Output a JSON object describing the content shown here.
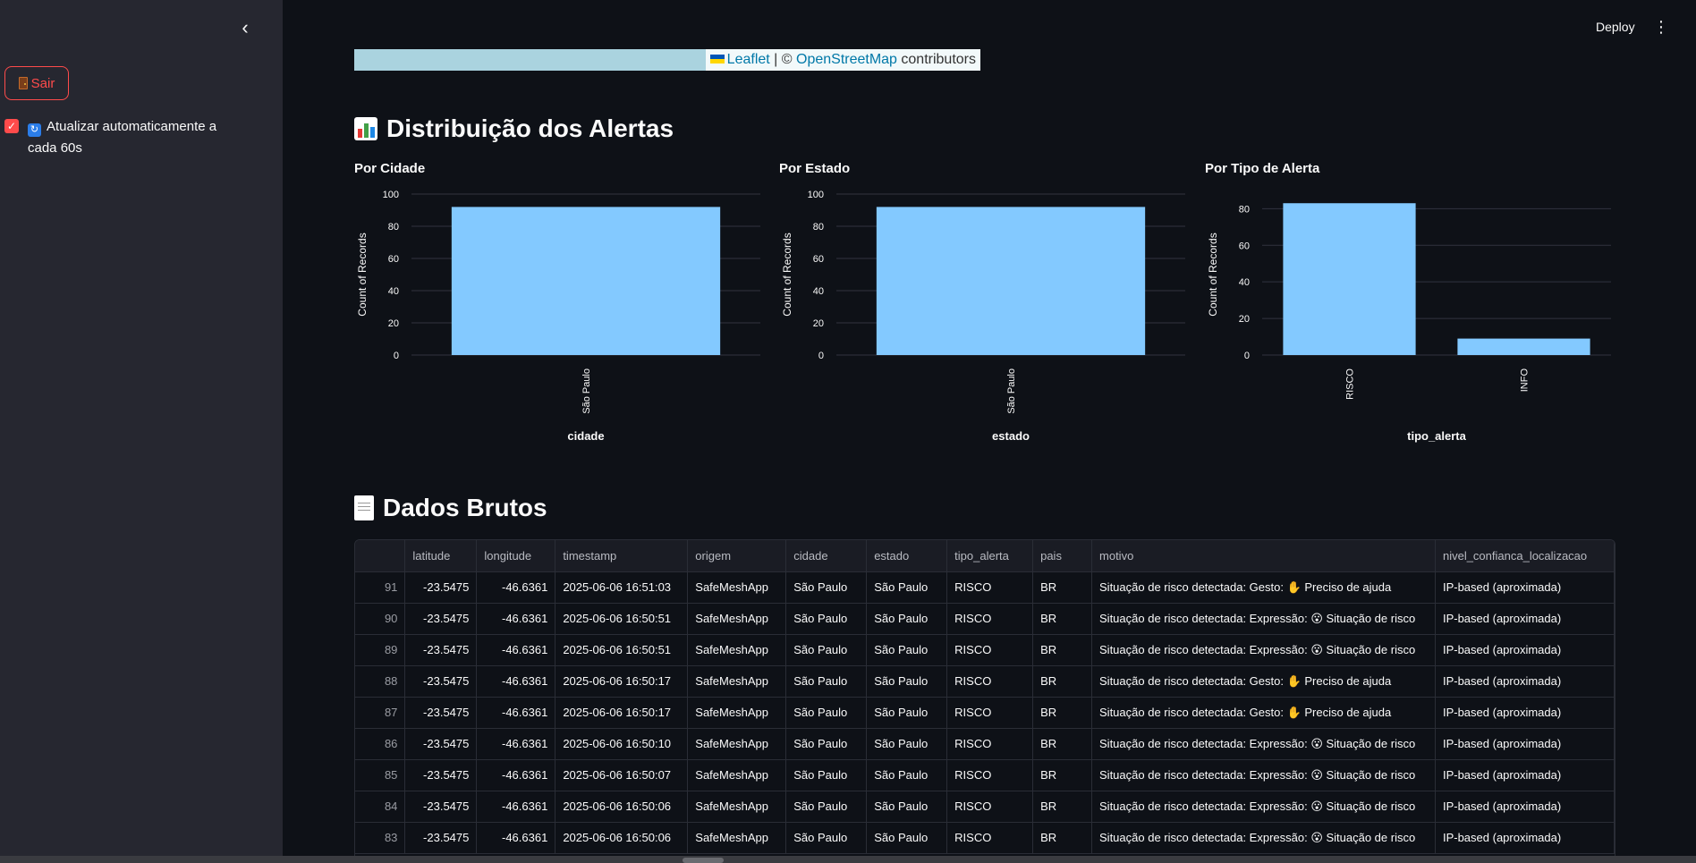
{
  "sidebar": {
    "collapse_icon": "chevron-left-icon",
    "logout_label": "Sair",
    "auto_refresh_label": "Atualizar automaticamente a cada 60s",
    "auto_refresh_checked": true
  },
  "header": {
    "deploy_label": "Deploy"
  },
  "map": {
    "attribution_leaflet": "Leaflet",
    "attribution_sep": " | © ",
    "attribution_osm": "OpenStreetMap",
    "attribution_rest": " contributors"
  },
  "section_alerts": {
    "title": "Distribuição dos Alertas"
  },
  "section_raw": {
    "title": "Dados Brutos"
  },
  "colors": {
    "bar": "#83c9ff",
    "accent": "#ff4b4b",
    "background": "#0e1117",
    "sidebar": "#262730"
  },
  "chart_data": [
    {
      "type": "bar",
      "title": "Por Cidade",
      "categories": [
        "São Paulo"
      ],
      "values": [
        92
      ],
      "xlabel": "cidade",
      "ylabel": "Count of Records",
      "ylim": [
        0,
        100
      ],
      "yticks": [
        0,
        20,
        40,
        60,
        80,
        100
      ],
      "grid": true
    },
    {
      "type": "bar",
      "title": "Por Estado",
      "categories": [
        "São Paulo"
      ],
      "values": [
        92
      ],
      "xlabel": "estado",
      "ylabel": "Count of Records",
      "ylim": [
        0,
        100
      ],
      "yticks": [
        0,
        20,
        40,
        60,
        80,
        100
      ],
      "grid": true
    },
    {
      "type": "bar",
      "title": "Por Tipo de Alerta",
      "categories": [
        "RISCO",
        "INFO"
      ],
      "values": [
        83,
        9
      ],
      "xlabel": "tipo_alerta",
      "ylabel": "Count of Records",
      "ylim": [
        0,
        88
      ],
      "yticks": [
        0,
        20,
        40,
        60,
        80
      ],
      "grid": true
    }
  ],
  "table": {
    "columns": [
      "",
      "latitude",
      "longitude",
      "timestamp",
      "origem",
      "cidade",
      "estado",
      "tipo_alerta",
      "pais",
      "motivo",
      "nivel_confianca_localizacao"
    ],
    "rows": [
      [
        "91",
        "-23.5475",
        "-46.6361",
        "2025-06-06 16:51:03",
        "SafeMeshApp",
        "São Paulo",
        "São Paulo",
        "RISCO",
        "BR",
        "Situação de risco detectada: Gesto: ✋ Preciso de ajuda",
        "IP-based (aproximada)"
      ],
      [
        "90",
        "-23.5475",
        "-46.6361",
        "2025-06-06 16:50:51",
        "SafeMeshApp",
        "São Paulo",
        "São Paulo",
        "RISCO",
        "BR",
        "Situação de risco detectada: Expressão: 😮 Situação de risco",
        "IP-based (aproximada)"
      ],
      [
        "89",
        "-23.5475",
        "-46.6361",
        "2025-06-06 16:50:51",
        "SafeMeshApp",
        "São Paulo",
        "São Paulo",
        "RISCO",
        "BR",
        "Situação de risco detectada: Expressão: 😮 Situação de risco",
        "IP-based (aproximada)"
      ],
      [
        "88",
        "-23.5475",
        "-46.6361",
        "2025-06-06 16:50:17",
        "SafeMeshApp",
        "São Paulo",
        "São Paulo",
        "RISCO",
        "BR",
        "Situação de risco detectada: Gesto: ✋ Preciso de ajuda",
        "IP-based (aproximada)"
      ],
      [
        "87",
        "-23.5475",
        "-46.6361",
        "2025-06-06 16:50:17",
        "SafeMeshApp",
        "São Paulo",
        "São Paulo",
        "RISCO",
        "BR",
        "Situação de risco detectada: Gesto: ✋ Preciso de ajuda",
        "IP-based (aproximada)"
      ],
      [
        "86",
        "-23.5475",
        "-46.6361",
        "2025-06-06 16:50:10",
        "SafeMeshApp",
        "São Paulo",
        "São Paulo",
        "RISCO",
        "BR",
        "Situação de risco detectada: Expressão: 😮 Situação de risco",
        "IP-based (aproximada)"
      ],
      [
        "85",
        "-23.5475",
        "-46.6361",
        "2025-06-06 16:50:07",
        "SafeMeshApp",
        "São Paulo",
        "São Paulo",
        "RISCO",
        "BR",
        "Situação de risco detectada: Expressão: 😮 Situação de risco",
        "IP-based (aproximada)"
      ],
      [
        "84",
        "-23.5475",
        "-46.6361",
        "2025-06-06 16:50:06",
        "SafeMeshApp",
        "São Paulo",
        "São Paulo",
        "RISCO",
        "BR",
        "Situação de risco detectada: Expressão: 😮 Situação de risco",
        "IP-based (aproximada)"
      ],
      [
        "83",
        "-23.5475",
        "-46.6361",
        "2025-06-06 16:50:06",
        "SafeMeshApp",
        "São Paulo",
        "São Paulo",
        "RISCO",
        "BR",
        "Situação de risco detectada: Expressão: 😮 Situação de risco",
        "IP-based (aproximada)"
      ]
    ]
  }
}
